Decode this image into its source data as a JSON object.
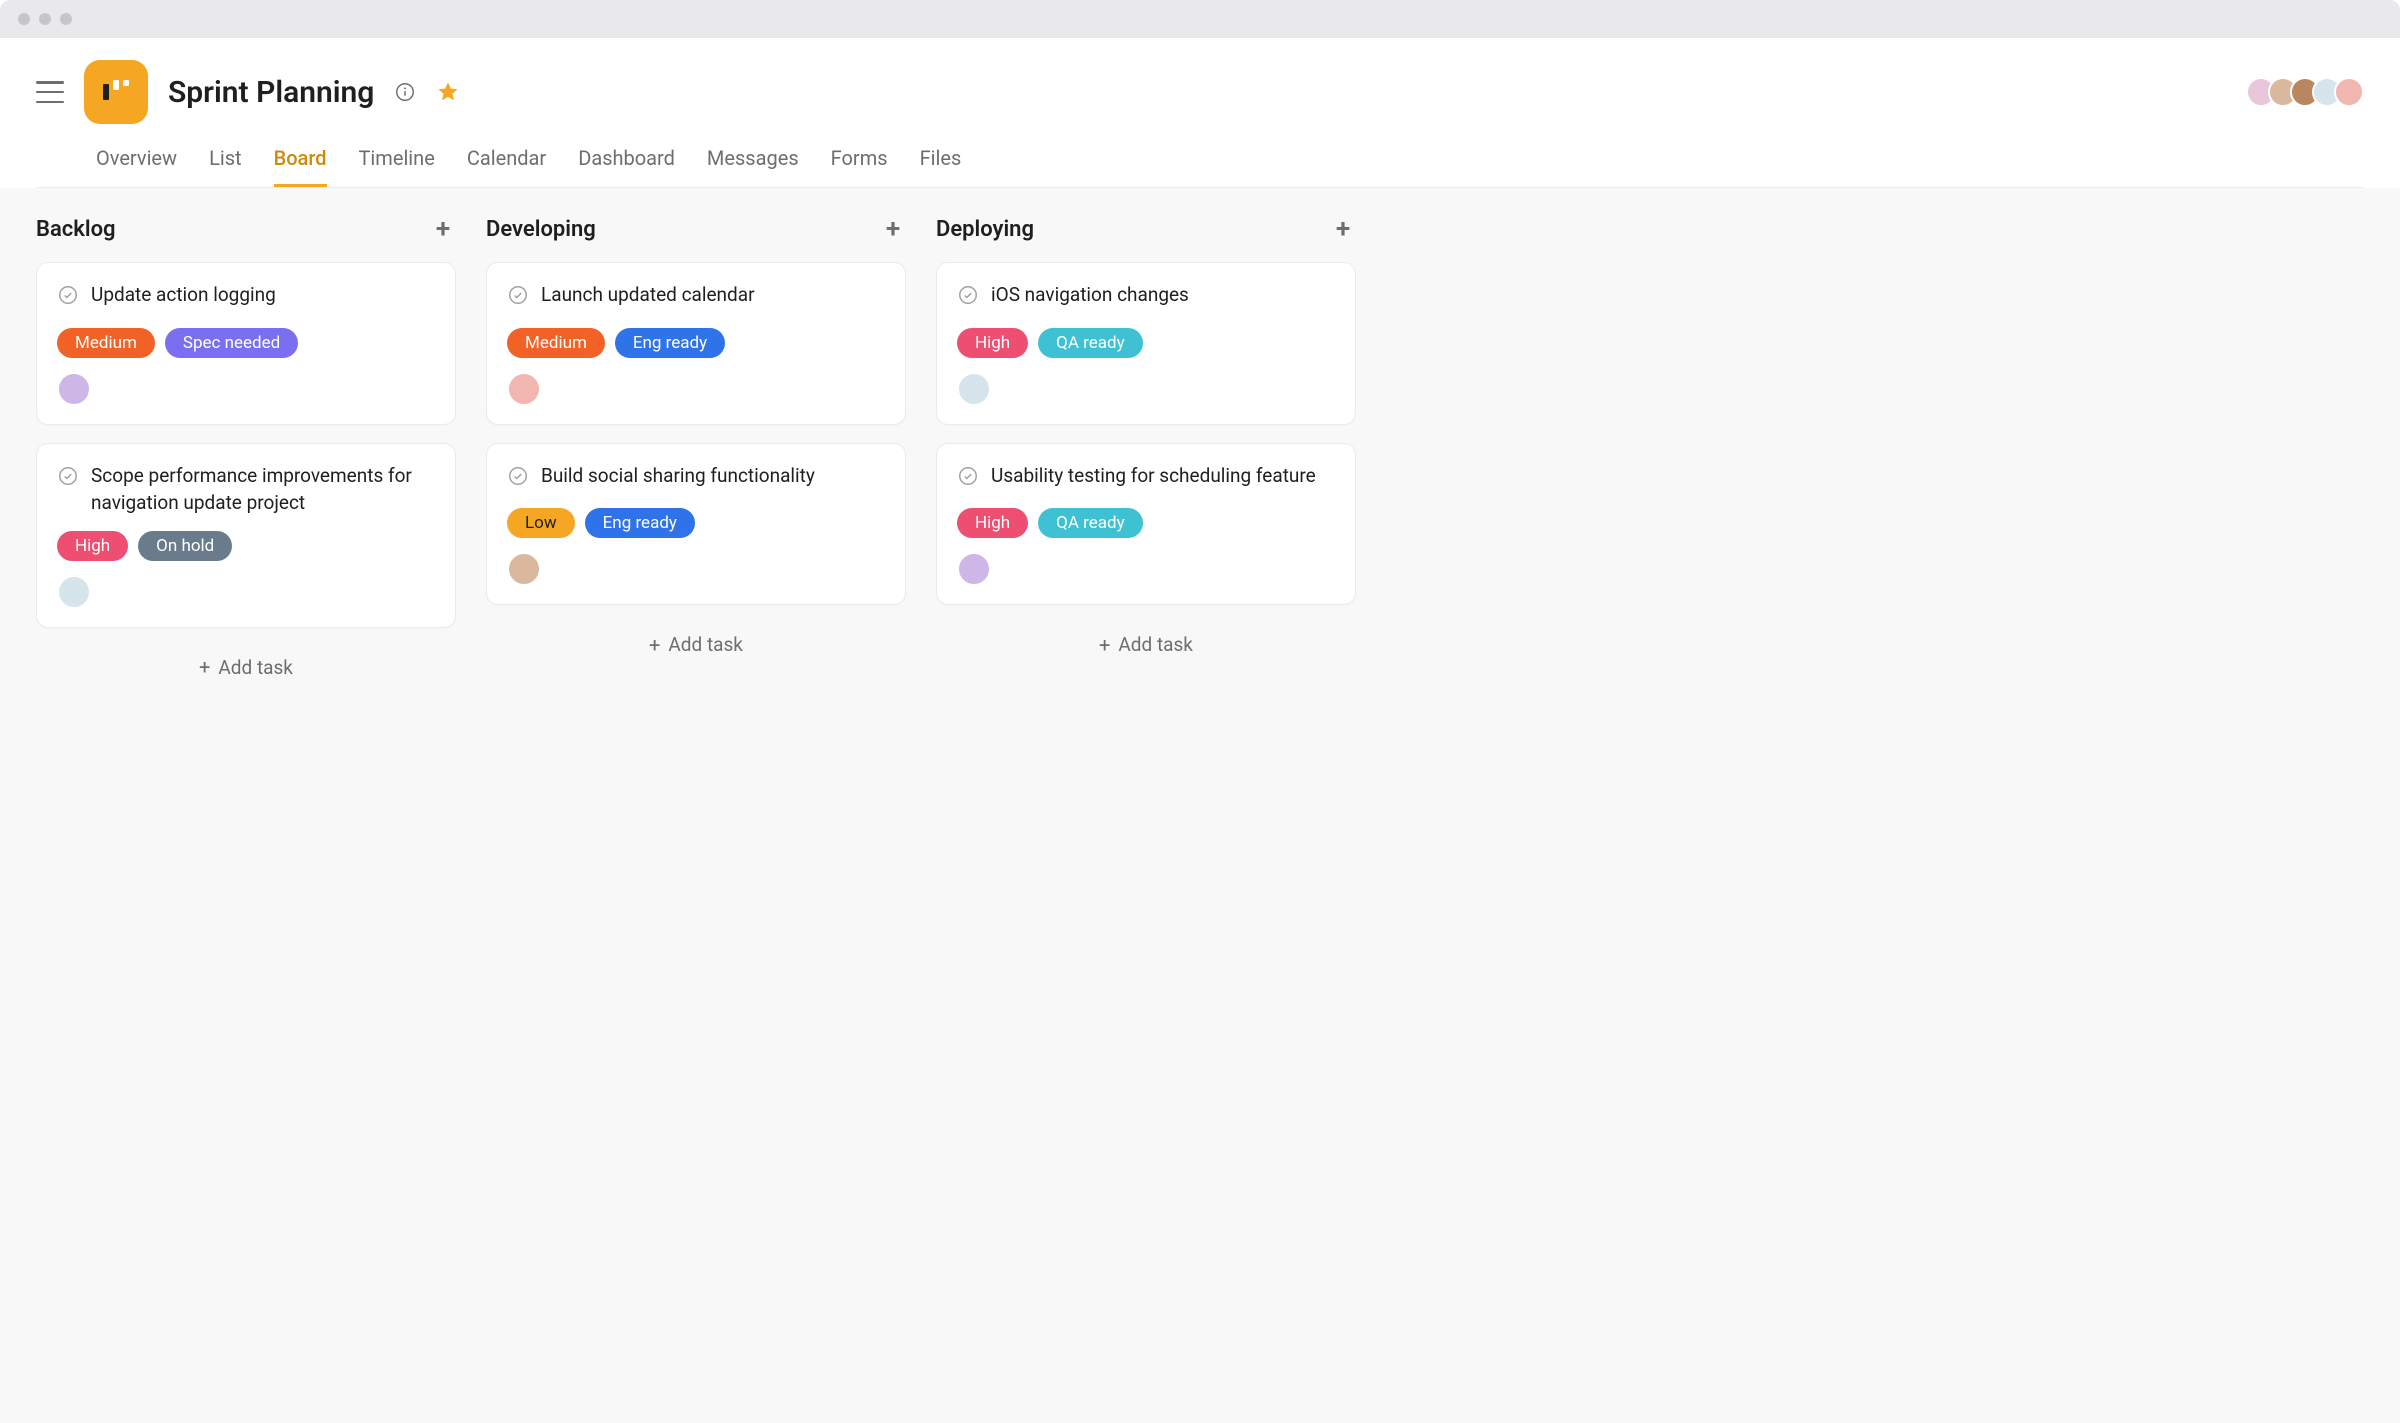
{
  "project": {
    "title": "Sprint Planning",
    "starred": true
  },
  "tabs": [
    {
      "label": "Overview",
      "active": false
    },
    {
      "label": "List",
      "active": false
    },
    {
      "label": "Board",
      "active": true
    },
    {
      "label": "Timeline",
      "active": false
    },
    {
      "label": "Calendar",
      "active": false
    },
    {
      "label": "Dashboard",
      "active": false
    },
    {
      "label": "Messages",
      "active": false
    },
    {
      "label": "Forms",
      "active": false
    },
    {
      "label": "Files",
      "active": false
    }
  ],
  "collaborators": [
    {
      "color": "#e9c7da"
    },
    {
      "color": "#d9b89e"
    },
    {
      "color": "#b8875f"
    },
    {
      "color": "#d6e4ec"
    },
    {
      "color": "#f1b6b0"
    }
  ],
  "tag_colors": {
    "Medium": "#f26125",
    "Spec needed": "#7a6ff0",
    "High": "#ee4e72",
    "On hold": "#6a7b8c",
    "Eng ready": "#2e73e9",
    "Low": "#f5a623",
    "QA ready": "#3ec1d3"
  },
  "add_task_label": "Add task",
  "columns": [
    {
      "title": "Backlog",
      "cards": [
        {
          "title": "Update action logging",
          "tags": [
            "Medium",
            "Spec needed"
          ],
          "assignee_color": "#cdb7e6"
        },
        {
          "title": "Scope performance improvements for navigation update project",
          "tags": [
            "High",
            "On hold"
          ],
          "assignee_color": "#d6e4ec"
        }
      ]
    },
    {
      "title": "Developing",
      "cards": [
        {
          "title": "Launch updated calendar",
          "tags": [
            "Medium",
            "Eng ready"
          ],
          "assignee_color": "#f1b6b0"
        },
        {
          "title": "Build social sharing functionality",
          "tags": [
            "Low",
            "Eng ready"
          ],
          "assignee_color": "#d9b89e"
        }
      ]
    },
    {
      "title": "Deploying",
      "cards": [
        {
          "title": "iOS navigation changes",
          "tags": [
            "High",
            "QA ready"
          ],
          "assignee_color": "#d6e4ec"
        },
        {
          "title": "Usability testing for scheduling feature",
          "tags": [
            "High",
            "QA ready"
          ],
          "assignee_color": "#cdb7e6"
        }
      ]
    }
  ]
}
